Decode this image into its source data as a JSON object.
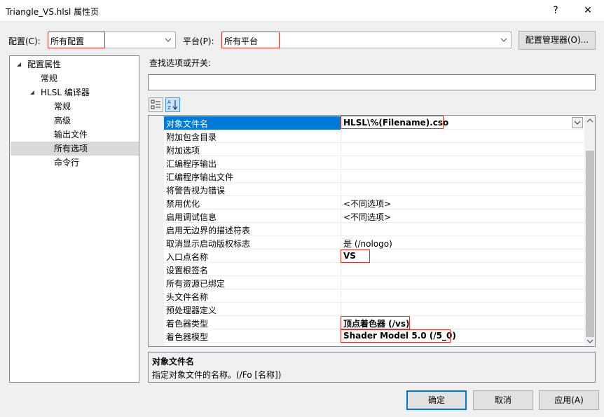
{
  "window": {
    "title": "Triangle_VS.hlsl 属性页",
    "help": "?",
    "close": "✕"
  },
  "config": {
    "label": "配置(C):",
    "value": "所有配置"
  },
  "platform": {
    "label": "平台(P):",
    "value": "所有平台"
  },
  "config_manager_label": "配置管理器(O)...",
  "tree": {
    "items": [
      {
        "label": "配置属性",
        "expanded": true
      },
      {
        "label": "常规"
      },
      {
        "label": "HLSL 编译器",
        "expanded": true
      },
      {
        "label": "常规"
      },
      {
        "label": "高级"
      },
      {
        "label": "输出文件"
      },
      {
        "label": "所有选项",
        "selected": true
      },
      {
        "label": "命令行"
      }
    ]
  },
  "search": {
    "label": "查找选项或开关:",
    "value": ""
  },
  "toolbar": {
    "categorized_icon": "categorized-icon",
    "alphabetical_icon": "sort-az-icon"
  },
  "properties": [
    {
      "name": "对象文件名",
      "value": "HLSL\\%(Filename).cso"
    },
    {
      "name": "附加包含目录",
      "value": ""
    },
    {
      "name": "附加选项",
      "value": ""
    },
    {
      "name": "汇编程序输出",
      "value": ""
    },
    {
      "name": "汇编程序输出文件",
      "value": ""
    },
    {
      "name": "将警告视为错误",
      "value": ""
    },
    {
      "name": "禁用优化",
      "value": "<不同选项>"
    },
    {
      "name": "启用调试信息",
      "value": "<不同选项>"
    },
    {
      "name": "启用无边界的描述符表",
      "value": ""
    },
    {
      "name": "取消显示启动版权标志",
      "value": "是 (/nologo)"
    },
    {
      "name": "入口点名称",
      "value": "VS"
    },
    {
      "name": "设置根签名",
      "value": ""
    },
    {
      "name": "所有资源已绑定",
      "value": ""
    },
    {
      "name": "头文件名称",
      "value": ""
    },
    {
      "name": "预处理器定义",
      "value": ""
    },
    {
      "name": "着色器类型",
      "value": "顶点着色器 (/vs)"
    },
    {
      "name": "着色器模型",
      "value": "Shader Model 5.0 (/5_0)"
    }
  ],
  "description": {
    "title": "对象文件名",
    "text": "指定对象文件的名称。(/Fo [名称])"
  },
  "buttons": {
    "ok": "确定",
    "cancel": "取消",
    "apply": "应用(A)"
  },
  "colors": {
    "selection": "#0078d7",
    "highlight_box": "#e0312b",
    "tree_selection": "#d9d9d9"
  }
}
